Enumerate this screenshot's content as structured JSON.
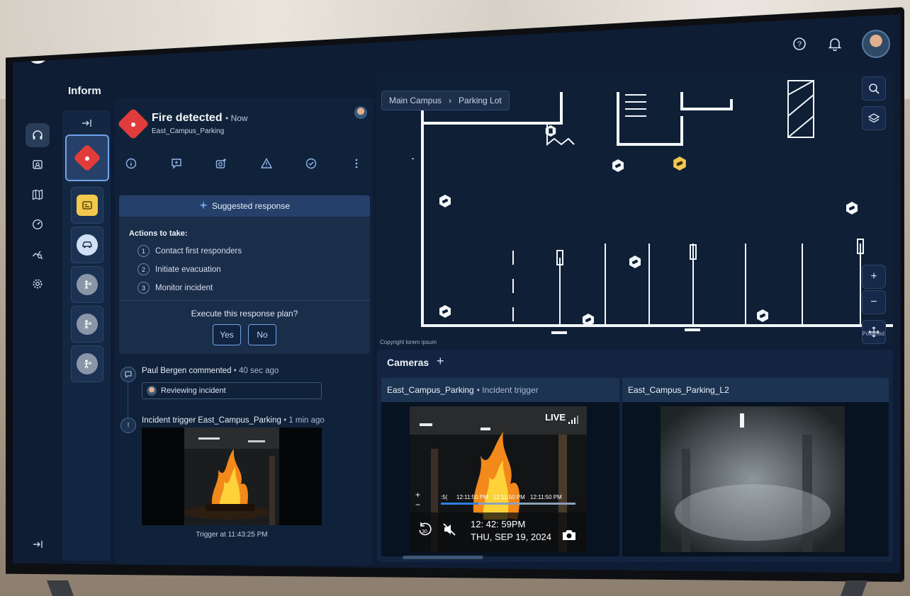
{
  "app": {
    "title": "Inform"
  },
  "header": {
    "help_icon": "help-circle-icon",
    "bell_icon": "bell-icon"
  },
  "rail": {
    "items": [
      {
        "icon": "headset-icon",
        "active": true
      },
      {
        "icon": "person-badge-icon"
      },
      {
        "icon": "map-icon"
      },
      {
        "icon": "gauge-icon"
      },
      {
        "icon": "analytics-search-icon"
      },
      {
        "icon": "gear-icon"
      }
    ],
    "collapse_icon": "collapse-right-icon"
  },
  "incident": {
    "title": "Fire detected",
    "time": "• Now",
    "location": "East_Campus_Parking",
    "actions": [
      "info-icon",
      "add-comment-icon",
      "add-camera-icon",
      "warning-icon",
      "check-circle-icon",
      "more-vertical-icon"
    ]
  },
  "suggested": {
    "title": "Suggested response",
    "actions_label": "Actions to take:",
    "steps": [
      {
        "n": "1",
        "label": "Contact first responders"
      },
      {
        "n": "2",
        "label": "Initiate evacuation"
      },
      {
        "n": "3",
        "label": "Monitor incident"
      }
    ],
    "prompt": "Execute this response plan?",
    "yes": "Yes",
    "no": "No"
  },
  "timeline": {
    "comment": {
      "author": "Paul Bergen commented",
      "time": "• 40 sec ago",
      "text": "Reviewing incident"
    },
    "trigger": {
      "title": "Incident trigger East_Campus_Parking",
      "time": "• 1 min ago",
      "caption": "Trigger at 11:43:25 PM"
    }
  },
  "map": {
    "breadcrumb": [
      "Main Campus",
      "Parking Lot"
    ],
    "copyright": "Copyright lorem ipsum",
    "powered": "Powered",
    "controls": [
      "search-icon",
      "layers-icon"
    ],
    "zoom": [
      "+",
      "−"
    ]
  },
  "cameras": {
    "title": "Cameras",
    "add": "+",
    "tiles": [
      {
        "name": "East_Campus_Parking",
        "status": "• Incident trigger",
        "live": "LIVE",
        "timestamps": [
          ":5(",
          "12:11:50 PM",
          "12:11:50 PM",
          "12:11:50 PM"
        ],
        "time": "12: 42: 59PM",
        "date": "THU, SEP 19, 2024",
        "rewind": "30"
      },
      {
        "name": "East_Campus_Parking_L2"
      }
    ]
  },
  "colors": {
    "accent": "#6fa4e8",
    "alert": "#e23b3b",
    "warning": "#f2c94c",
    "background": "#0e1d33"
  }
}
